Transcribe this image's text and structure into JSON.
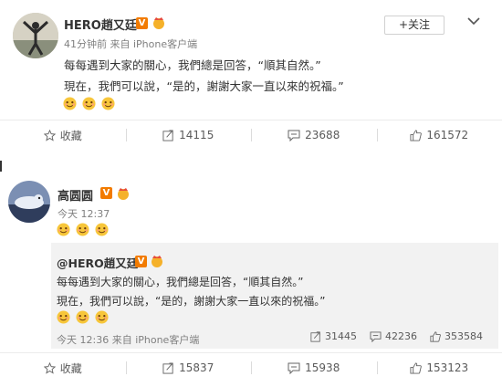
{
  "post1": {
    "author": "HERO趙又廷",
    "verified_badge": "V",
    "meta": "41分钟前 来自 iPhone客户端",
    "follow_label": "+关注",
    "lines": [
      "每每遇到大家的關心，我們總是回答，“順其自然。”",
      "現在，我們可以說，“是的，謝謝大家一直以來的祝福。”"
    ],
    "actions": {
      "favorite": "收藏",
      "repost": "14115",
      "comment": "23688",
      "like": "161572"
    }
  },
  "post2": {
    "author": "高圆圆",
    "verified_badge": "V",
    "meta": "今天 12:37",
    "quoted": {
      "author": "@HERO趙又廷",
      "verified_badge": "V",
      "lines": [
        "每每遇到大家的關心，我們總是回答，“順其自然。”",
        "現在，我們可以說，“是的，謝謝大家一直以來的祝福。”"
      ],
      "meta": "今天 12:36 来自 iPhone客户端",
      "stats": {
        "repost": "31445",
        "comment": "42236",
        "like": "353584"
      }
    },
    "actions": {
      "favorite": "收藏",
      "repost": "15837",
      "comment": "15938",
      "like": "153123"
    }
  },
  "icons": [
    "avatar-hero",
    "avatar-gao",
    "verified-badge-icon",
    "crown-icon",
    "chevron-down-icon",
    "emoji-face-icon",
    "star-icon",
    "repost-icon",
    "comment-icon",
    "like-icon"
  ],
  "colors": {
    "badge": "#f27b00",
    "text": "#333333",
    "muted": "#808080",
    "quote_bg": "#f2f2f2"
  }
}
